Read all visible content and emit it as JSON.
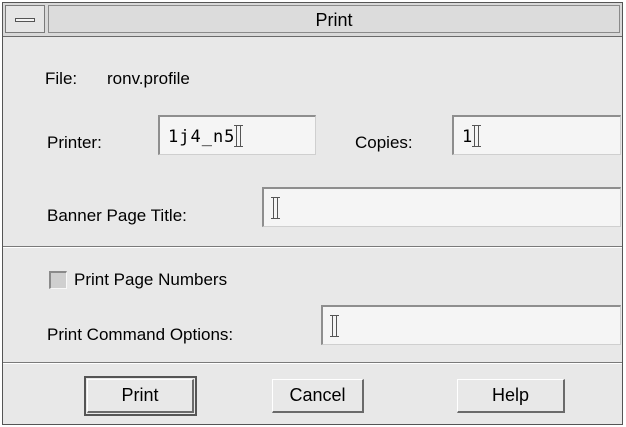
{
  "window": {
    "title": "Print"
  },
  "file": {
    "label": "File:",
    "value": "ronv.profile"
  },
  "printer": {
    "label": "Printer:",
    "value": "1j4_n5"
  },
  "copies": {
    "label": "Copies:",
    "value": "1"
  },
  "banner": {
    "label": "Banner Page Title:",
    "value": ""
  },
  "page_numbers": {
    "label": "Print Page Numbers",
    "checked": false
  },
  "command_options": {
    "label": "Print Command Options:",
    "value": ""
  },
  "buttons": {
    "print": "Print",
    "cancel": "Cancel",
    "help": "Help"
  }
}
